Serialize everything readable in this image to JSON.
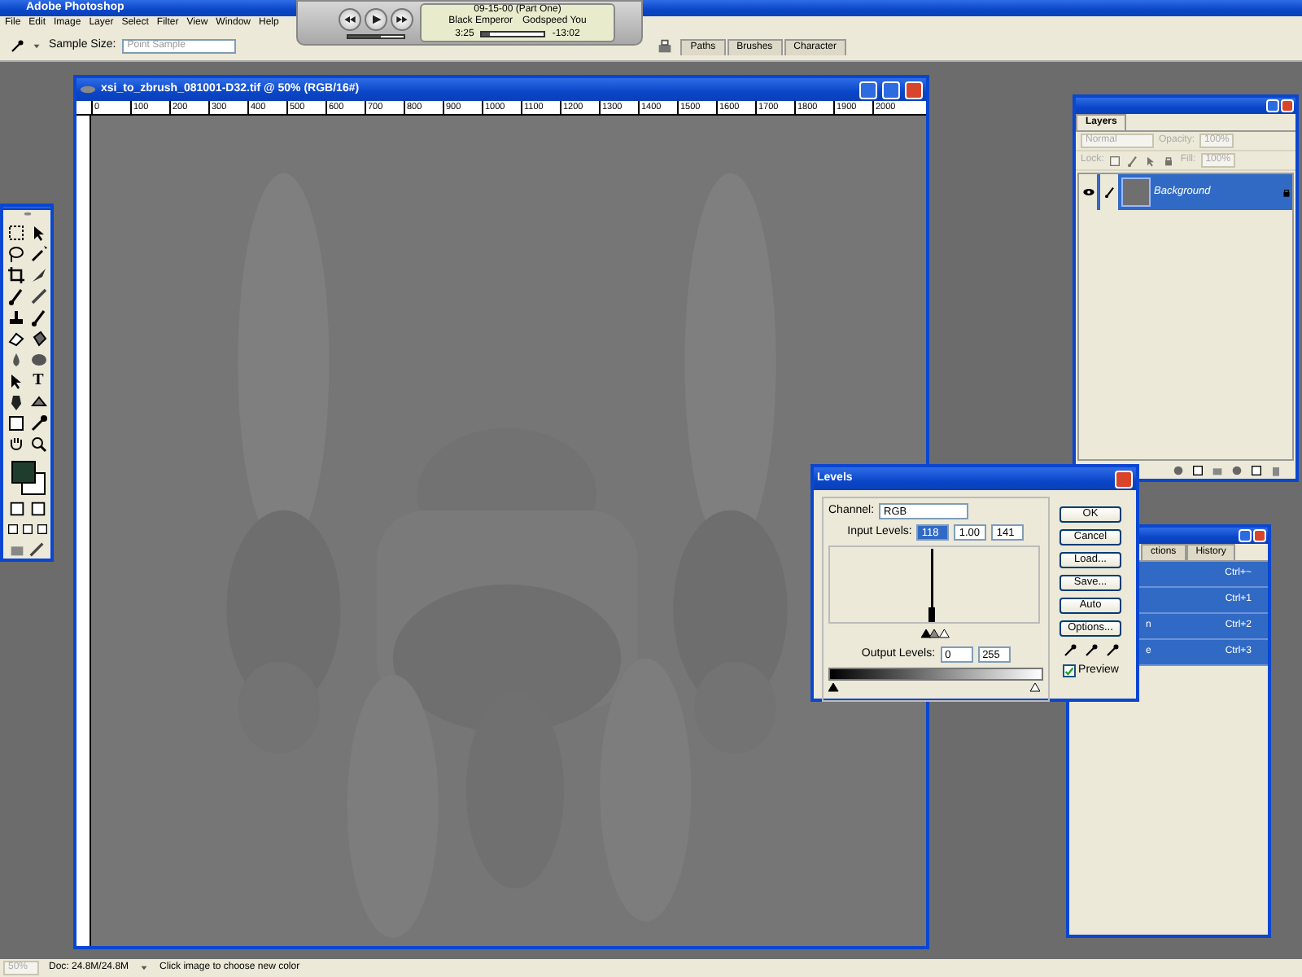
{
  "app": {
    "title": "Adobe Photoshop"
  },
  "menu": [
    "File",
    "Edit",
    "Image",
    "Layer",
    "Select",
    "Filter",
    "View",
    "Window",
    "Help"
  ],
  "options_bar": {
    "sample_size_label": "Sample Size:",
    "sample_size": "Point Sample",
    "palette_tabs": [
      "Paths",
      "Brushes",
      "Character"
    ]
  },
  "media_player": {
    "track": "09-15-00 (Part One)",
    "artist": "Black Emperor",
    "album": "Godspeed You",
    "elapsed": "3:25",
    "remaining": "-13:02",
    "progress": {
      "level": 0.12
    },
    "volume": {
      "level": 0.6
    }
  },
  "document": {
    "title": "xsi_to_zbrush_081001-D32.tif @ 50% (RGB/16#)",
    "ruler_labels": [
      "0",
      "100",
      "200",
      "300",
      "400",
      "500",
      "600",
      "700",
      "800",
      "900",
      "1000",
      "1100",
      "1200",
      "1300",
      "1400",
      "1500",
      "1600",
      "1700",
      "1800",
      "1900",
      "2000"
    ]
  },
  "toolbox": {
    "text_tool_glyph": "T"
  },
  "layers_panel": {
    "tab": "Layers",
    "blend_mode": "Normal",
    "opacity_label": "Opacity:",
    "opacity": "100%",
    "lock_label": "Lock:",
    "fill_label": "Fill:",
    "fill": "100%",
    "layers": [
      {
        "name": "Background",
        "selected": true,
        "visible": true
      }
    ]
  },
  "channels_panel": {
    "tabs": [
      "ctions",
      "History"
    ],
    "rows": [
      {
        "shortcut": "Ctrl+~",
        "selected": true
      },
      {
        "shortcut": "Ctrl+1",
        "selected": true
      },
      {
        "label": "n",
        "shortcut": "Ctrl+2",
        "selected": true
      },
      {
        "label": "e",
        "shortcut": "Ctrl+3",
        "selected": true
      }
    ]
  },
  "levels_dialog": {
    "title": "Levels",
    "channel_label": "Channel:",
    "channel": "RGB",
    "input_label": "Input Levels:",
    "input": [
      "118",
      "1.00",
      "141"
    ],
    "input_slider": [
      {
        "level": 0.46
      },
      {
        "level": 0.5
      },
      {
        "level": 0.55
      }
    ],
    "output_slider": [
      {
        "level": 0
      },
      {
        "level": 1
      }
    ],
    "output_label": "Output Levels:",
    "output": [
      "0",
      "255"
    ],
    "buttons": [
      "OK",
      "Cancel",
      "Load...",
      "Save...",
      "Auto",
      "Options..."
    ],
    "preview": {
      "label": "Preview",
      "checked": true
    }
  },
  "status_bar": {
    "zoom": "50%",
    "doc": "Doc: 24.8M/24.8M",
    "hint": "Click image to choose new color"
  }
}
